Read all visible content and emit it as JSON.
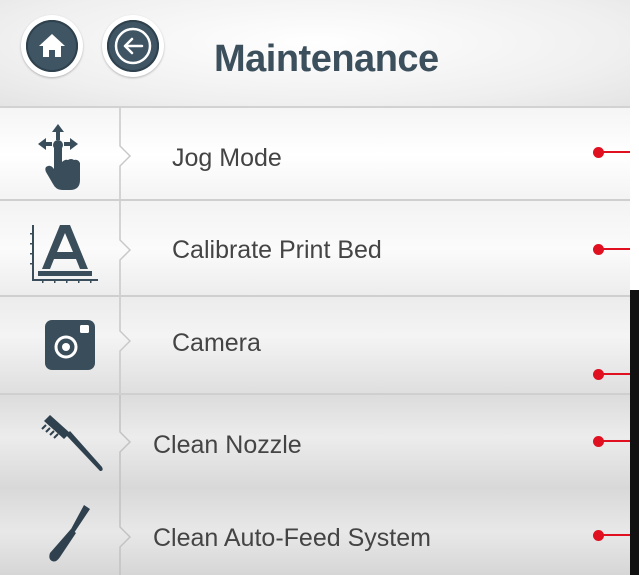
{
  "header": {
    "title": "Maintenance",
    "home_icon": "home-icon",
    "back_icon": "arrow-left-icon"
  },
  "menu": {
    "items": [
      {
        "label": "Jog Mode",
        "icon": "hand-move-icon"
      },
      {
        "label": "Calibrate Print Bed",
        "icon": "calibrate-bed-icon"
      },
      {
        "label": "Camera",
        "icon": "camera-icon"
      },
      {
        "label": "Clean Nozzle",
        "icon": "brush-icon"
      },
      {
        "label": "Clean Auto-Feed System",
        "icon": "screwdriver-icon"
      }
    ]
  },
  "colors": {
    "accent_dark": "#3f5564",
    "marker_red": "#e01020"
  }
}
